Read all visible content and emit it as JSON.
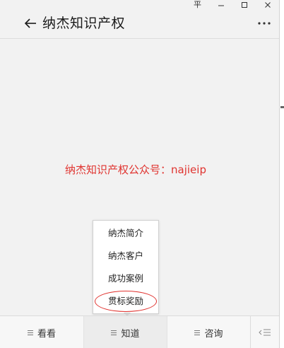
{
  "window": {
    "controls": {
      "pin_glyph": "平",
      "minimize_icon": "minimize-icon",
      "maximize_icon": "maximize-icon",
      "close_icon": "close-icon"
    }
  },
  "header": {
    "title": "纳杰知识产权",
    "back_icon": "arrow-left-icon",
    "more_icon": "more-dots-icon"
  },
  "content": {
    "notice": "纳杰知识产权公众号：najieip"
  },
  "popup": {
    "items": [
      {
        "label": "纳杰简介"
      },
      {
        "label": "纳杰客户"
      },
      {
        "label": "成功案例"
      },
      {
        "label": "贯标奖励"
      }
    ],
    "highlighted_index": 3,
    "highlight_color": "#e0332f"
  },
  "bottombar": {
    "tabs": [
      {
        "label": "看看",
        "icon": "menu-lines-icon"
      },
      {
        "label": "知道",
        "icon": "menu-lines-icon",
        "active": true
      },
      {
        "label": "咨询",
        "icon": "menu-lines-icon"
      }
    ],
    "toggle_icon": "keyboard-toggle-icon"
  },
  "colors": {
    "accent_red": "#e0332f",
    "background": "#f2f2f2"
  }
}
